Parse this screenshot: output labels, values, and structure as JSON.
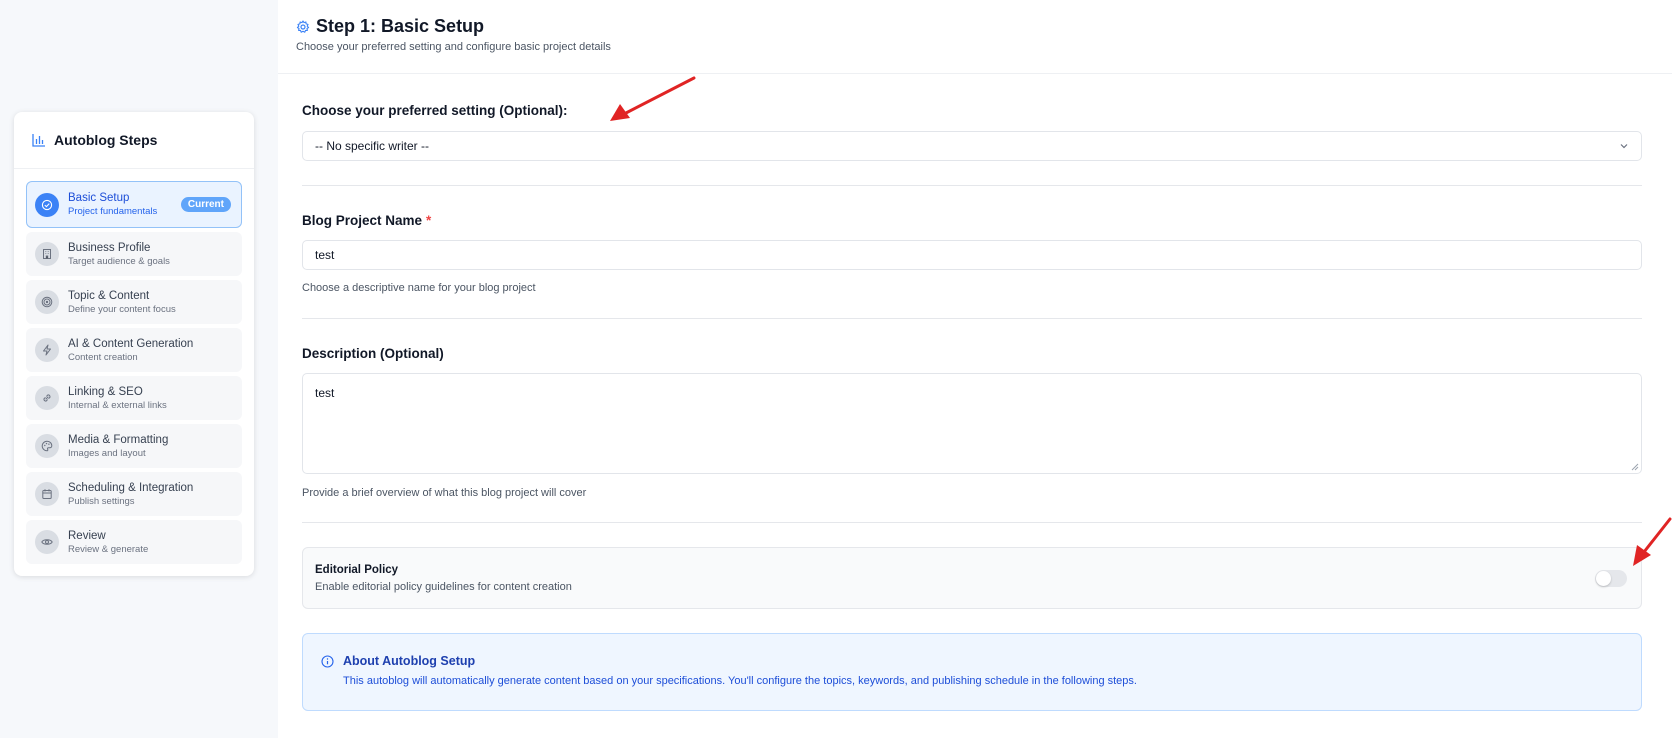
{
  "sidebar": {
    "title": "Autoblog Steps",
    "current_badge": "Current",
    "steps": [
      {
        "label": "Basic Setup",
        "sub": "Project fundamentals",
        "icon": "check-circle-icon"
      },
      {
        "label": "Business Profile",
        "sub": "Target audience & goals",
        "icon": "building-icon"
      },
      {
        "label": "Topic & Content",
        "sub": "Define your content focus",
        "icon": "target-icon"
      },
      {
        "label": "AI & Content Generation",
        "sub": "Content creation",
        "icon": "lightning-icon"
      },
      {
        "label": "Linking & SEO",
        "sub": "Internal & external links",
        "icon": "link-icon"
      },
      {
        "label": "Media & Formatting",
        "sub": "Images and layout",
        "icon": "palette-icon"
      },
      {
        "label": "Scheduling & Integration",
        "sub": "Publish settings",
        "icon": "calendar-icon"
      },
      {
        "label": "Review",
        "sub": "Review & generate",
        "icon": "eye-icon"
      }
    ]
  },
  "header": {
    "title": "Step 1: Basic Setup",
    "subtitle": "Choose your preferred setting and configure basic project details"
  },
  "form": {
    "setting_label": "Choose your preferred setting (Optional):",
    "setting_value": "-- No specific writer --",
    "name_label": "Blog Project Name",
    "name_required": "*",
    "name_value": "test",
    "name_help": "Choose a descriptive name for your blog project",
    "description_label": "Description (Optional)",
    "description_value": "test",
    "description_help": "Provide a brief overview of what this blog project will cover",
    "policy_title": "Editorial Policy",
    "policy_sub": "Enable editorial policy guidelines for content creation",
    "policy_enabled": false
  },
  "info": {
    "title": "About Autoblog Setup",
    "text": "This autoblog will automatically generate content based on your specifications. You'll configure the topics, keywords, and publishing schedule in the following steps."
  },
  "colors": {
    "accent": "#3b82f6",
    "annotation_arrow": "#e02424"
  }
}
